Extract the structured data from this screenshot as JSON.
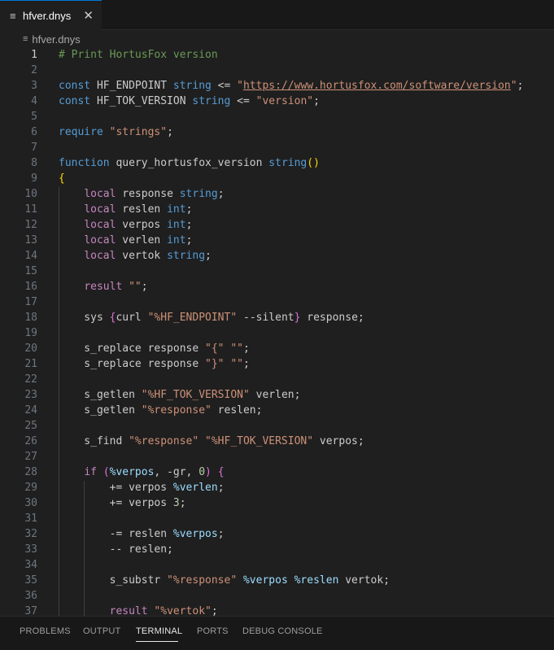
{
  "tab": {
    "icon": "lines-file-icon",
    "label": "hfver.dnys",
    "close_icon": "close-icon",
    "close_glyph": "✕"
  },
  "breadcrumb": {
    "icon": "lines-file-icon",
    "label": "hfver.dnys"
  },
  "editor": {
    "active_line": 1,
    "lines": [
      {
        "n": "1",
        "tokens": [
          [
            "# Print HortusFox version",
            "comment"
          ]
        ]
      },
      {
        "n": "2",
        "tokens": []
      },
      {
        "n": "3",
        "tokens": [
          [
            "const",
            "keyword"
          ],
          [
            " HF_ENDPOINT ",
            "ident"
          ],
          [
            "string",
            "keyword"
          ],
          [
            " <= ",
            "ident"
          ],
          [
            "\"",
            "string"
          ],
          [
            "https://www.hortusfox.com/software/version",
            "url"
          ],
          [
            "\"",
            "string"
          ],
          [
            ";",
            "ident"
          ]
        ]
      },
      {
        "n": "4",
        "tokens": [
          [
            "const",
            "keyword"
          ],
          [
            " HF_TOK_VERSION ",
            "ident"
          ],
          [
            "string",
            "keyword"
          ],
          [
            " <= ",
            "ident"
          ],
          [
            "\"version\"",
            "string"
          ],
          [
            ";",
            "ident"
          ]
        ]
      },
      {
        "n": "5",
        "tokens": []
      },
      {
        "n": "6",
        "tokens": [
          [
            "require",
            "keyword"
          ],
          [
            " ",
            "ident"
          ],
          [
            "\"strings\"",
            "string"
          ],
          [
            ";",
            "ident"
          ]
        ]
      },
      {
        "n": "7",
        "tokens": []
      },
      {
        "n": "8",
        "tokens": [
          [
            "function",
            "keyword"
          ],
          [
            " query_hortusfox_version ",
            "ident"
          ],
          [
            "string",
            "keyword"
          ],
          [
            "()",
            "bracket-1"
          ]
        ]
      },
      {
        "n": "9",
        "tokens": [
          [
            "{",
            "bracket-1"
          ]
        ]
      },
      {
        "n": "10",
        "tokens": [
          [
            "    ",
            "ident"
          ],
          [
            "local",
            "control"
          ],
          [
            " response ",
            "ident"
          ],
          [
            "string",
            "keyword"
          ],
          [
            ";",
            "ident"
          ]
        ]
      },
      {
        "n": "11",
        "tokens": [
          [
            "    ",
            "ident"
          ],
          [
            "local",
            "control"
          ],
          [
            " reslen ",
            "ident"
          ],
          [
            "int",
            "keyword"
          ],
          [
            ";",
            "ident"
          ]
        ]
      },
      {
        "n": "12",
        "tokens": [
          [
            "    ",
            "ident"
          ],
          [
            "local",
            "control"
          ],
          [
            " verpos ",
            "ident"
          ],
          [
            "int",
            "keyword"
          ],
          [
            ";",
            "ident"
          ]
        ]
      },
      {
        "n": "13",
        "tokens": [
          [
            "    ",
            "ident"
          ],
          [
            "local",
            "control"
          ],
          [
            " verlen ",
            "ident"
          ],
          [
            "int",
            "keyword"
          ],
          [
            ";",
            "ident"
          ]
        ]
      },
      {
        "n": "14",
        "tokens": [
          [
            "    ",
            "ident"
          ],
          [
            "local",
            "control"
          ],
          [
            " vertok ",
            "ident"
          ],
          [
            "string",
            "keyword"
          ],
          [
            ";",
            "ident"
          ]
        ]
      },
      {
        "n": "15",
        "tokens": []
      },
      {
        "n": "16",
        "tokens": [
          [
            "    ",
            "ident"
          ],
          [
            "result",
            "control"
          ],
          [
            " ",
            "ident"
          ],
          [
            "\"\"",
            "string"
          ],
          [
            ";",
            "ident"
          ]
        ]
      },
      {
        "n": "17",
        "tokens": []
      },
      {
        "n": "18",
        "tokens": [
          [
            "    sys ",
            "ident"
          ],
          [
            "{",
            "bracket-2"
          ],
          [
            "curl ",
            "ident"
          ],
          [
            "\"%HF_ENDPOINT\"",
            "string"
          ],
          [
            " --silent",
            "ident"
          ],
          [
            "}",
            "bracket-2"
          ],
          [
            " response;",
            "ident"
          ]
        ]
      },
      {
        "n": "19",
        "tokens": []
      },
      {
        "n": "20",
        "tokens": [
          [
            "    s_replace response ",
            "ident"
          ],
          [
            "\"{\"",
            "string"
          ],
          [
            " ",
            "ident"
          ],
          [
            "\"\"",
            "string"
          ],
          [
            ";",
            "ident"
          ]
        ]
      },
      {
        "n": "21",
        "tokens": [
          [
            "    s_replace response ",
            "ident"
          ],
          [
            "\"}\"",
            "string"
          ],
          [
            " ",
            "ident"
          ],
          [
            "\"\"",
            "string"
          ],
          [
            ";",
            "ident"
          ]
        ]
      },
      {
        "n": "22",
        "tokens": []
      },
      {
        "n": "23",
        "tokens": [
          [
            "    s_getlen ",
            "ident"
          ],
          [
            "\"%HF_TOK_VERSION\"",
            "string"
          ],
          [
            " verlen;",
            "ident"
          ]
        ]
      },
      {
        "n": "24",
        "tokens": [
          [
            "    s_getlen ",
            "ident"
          ],
          [
            "\"%response\"",
            "string"
          ],
          [
            " reslen;",
            "ident"
          ]
        ]
      },
      {
        "n": "25",
        "tokens": []
      },
      {
        "n": "26",
        "tokens": [
          [
            "    s_find ",
            "ident"
          ],
          [
            "\"%response\"",
            "string"
          ],
          [
            " ",
            "ident"
          ],
          [
            "\"%HF_TOK_VERSION\"",
            "string"
          ],
          [
            " verpos;",
            "ident"
          ]
        ]
      },
      {
        "n": "27",
        "tokens": []
      },
      {
        "n": "28",
        "tokens": [
          [
            "    ",
            "ident"
          ],
          [
            "if",
            "control"
          ],
          [
            " ",
            "ident"
          ],
          [
            "(",
            "bracket-2"
          ],
          [
            "%verpos",
            "variable"
          ],
          [
            ", -gr, ",
            "ident"
          ],
          [
            "0",
            "number"
          ],
          [
            ")",
            "bracket-2"
          ],
          [
            " ",
            "ident"
          ],
          [
            "{",
            "bracket-2"
          ]
        ]
      },
      {
        "n": "29",
        "tokens": [
          [
            "        += verpos ",
            "ident"
          ],
          [
            "%verlen",
            "variable"
          ],
          [
            ";",
            "ident"
          ]
        ]
      },
      {
        "n": "30",
        "tokens": [
          [
            "        += verpos ",
            "ident"
          ],
          [
            "3",
            "number"
          ],
          [
            ";",
            "ident"
          ]
        ]
      },
      {
        "n": "31",
        "tokens": []
      },
      {
        "n": "32",
        "tokens": [
          [
            "        -= reslen ",
            "ident"
          ],
          [
            "%verpos",
            "variable"
          ],
          [
            ";",
            "ident"
          ]
        ]
      },
      {
        "n": "33",
        "tokens": [
          [
            "        -- reslen;",
            "ident"
          ]
        ]
      },
      {
        "n": "34",
        "tokens": []
      },
      {
        "n": "35",
        "tokens": [
          [
            "        s_substr ",
            "ident"
          ],
          [
            "\"%response\"",
            "string"
          ],
          [
            " ",
            "ident"
          ],
          [
            "%verpos",
            "variable"
          ],
          [
            " ",
            "ident"
          ],
          [
            "%reslen",
            "variable"
          ],
          [
            " vertok;",
            "ident"
          ]
        ]
      },
      {
        "n": "36",
        "tokens": []
      },
      {
        "n": "37",
        "tokens": [
          [
            "        ",
            "ident"
          ],
          [
            "result",
            "control"
          ],
          [
            " ",
            "ident"
          ],
          [
            "\"%vertok\"",
            "string"
          ],
          [
            ";",
            "ident"
          ]
        ]
      }
    ]
  },
  "panel": {
    "tabs": [
      "PROBLEMS",
      "OUTPUT",
      "TERMINAL",
      "PORTS",
      "DEBUG CONSOLE"
    ],
    "active": "TERMINAL"
  }
}
